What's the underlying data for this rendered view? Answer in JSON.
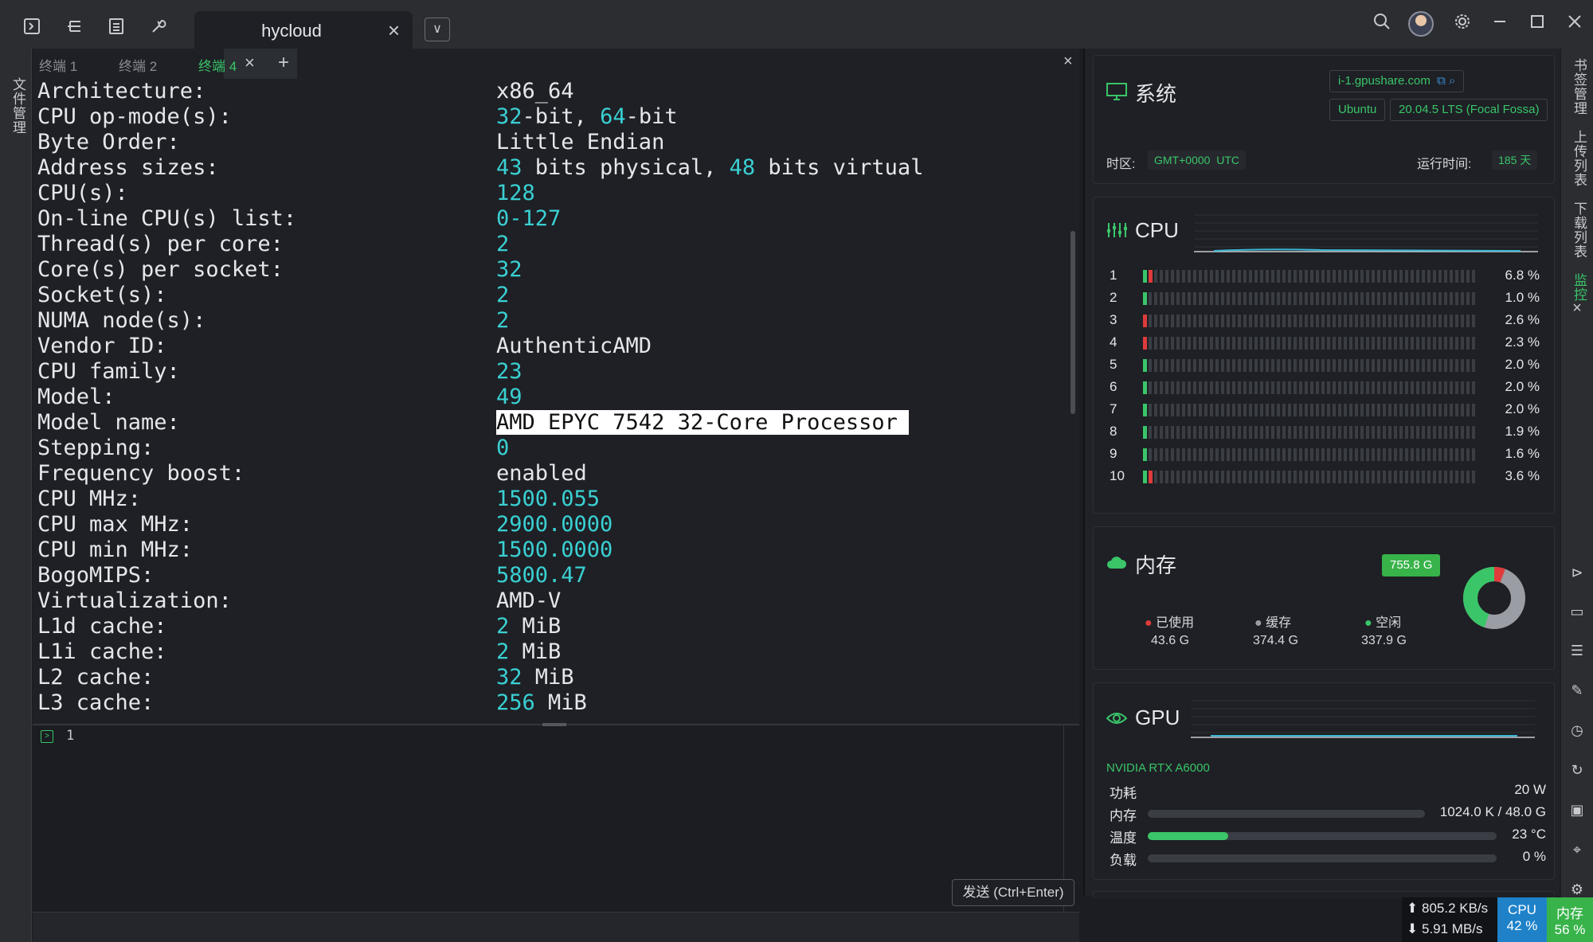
{
  "tabs": {
    "main_title": "hycloud"
  },
  "left_strip": {
    "label": "文件管理"
  },
  "terminal_tabs": [
    {
      "label": "终端 1"
    },
    {
      "label": "终端 2"
    },
    {
      "label": "终端 4"
    }
  ],
  "terminal": {
    "lines": [
      {
        "key": "Architecture:",
        "value": "x86_64"
      },
      {
        "key": "CPU op-mode(s):",
        "value_parts": [
          "32",
          "-bit, ",
          "64",
          "-bit"
        ]
      },
      {
        "key": "Byte Order:",
        "value": "Little Endian"
      },
      {
        "key": "Address sizes:",
        "value_parts": [
          "43",
          " bits physical, ",
          "48",
          " bits virtual"
        ]
      },
      {
        "key": "CPU(s):",
        "value": "128"
      },
      {
        "key": "On-line CPU(s) list:",
        "value": "0-127"
      },
      {
        "key": "Thread(s) per core:",
        "value": "2"
      },
      {
        "key": "Core(s) per socket:",
        "value": "32"
      },
      {
        "key": "Socket(s):",
        "value": "2"
      },
      {
        "key": "NUMA node(s):",
        "value": "2"
      },
      {
        "key": "Vendor ID:",
        "value": "AuthenticAMD"
      },
      {
        "key": "CPU family:",
        "value": "23"
      },
      {
        "key": "Model:",
        "value": "49"
      },
      {
        "key": "Model name:",
        "value": "AMD EPYC 7542 32-Core Processor"
      },
      {
        "key": "Stepping:",
        "value": "0"
      },
      {
        "key": "Frequency boost:",
        "value": "enabled"
      },
      {
        "key": "CPU MHz:",
        "value": "1500.055"
      },
      {
        "key": "CPU max MHz:",
        "value": "2900.0000"
      },
      {
        "key": "CPU min MHz:",
        "value": "1500.0000"
      },
      {
        "key": "BogoMIPS:",
        "value": "5800.47"
      },
      {
        "key": "Virtualization:",
        "value": "AMD-V"
      },
      {
        "key": "L1d cache:",
        "value_parts": [
          "2",
          " MiB"
        ]
      },
      {
        "key": "L1i cache:",
        "value_parts": [
          "2",
          " MiB"
        ]
      },
      {
        "key": "L2 cache:",
        "value_parts": [
          "32",
          " MiB"
        ]
      },
      {
        "key": "L3 cache:",
        "value_parts": [
          "256",
          " MiB"
        ]
      }
    ]
  },
  "input": {
    "line_number": "1",
    "send_label": "发送 (Ctrl+Enter)"
  },
  "system": {
    "title": "系统",
    "host": "i-1.gpushare.com",
    "os": "Ubuntu",
    "version": "20.04.5 LTS (Focal Fossa)",
    "tz_label": "时区:",
    "tz_value": "GMT+0000",
    "tz_name": "UTC",
    "uptime_label": "运行时间:",
    "uptime_value": "185 天"
  },
  "cpu": {
    "title": "CPU",
    "cores": [
      {
        "idx": "1",
        "pct": "6.8 %",
        "value": 6.8
      },
      {
        "idx": "2",
        "pct": "1.0 %",
        "value": 1.0
      },
      {
        "idx": "3",
        "pct": "2.6 %",
        "value": 2.6
      },
      {
        "idx": "4",
        "pct": "2.3 %",
        "value": 2.3
      },
      {
        "idx": "5",
        "pct": "2.0 %",
        "value": 2.0
      },
      {
        "idx": "6",
        "pct": "2.0 %",
        "value": 2.0
      },
      {
        "idx": "7",
        "pct": "2.0 %",
        "value": 2.0
      },
      {
        "idx": "8",
        "pct": "1.9 %",
        "value": 1.9
      },
      {
        "idx": "9",
        "pct": "1.6 %",
        "value": 1.6
      },
      {
        "idx": "10",
        "pct": "3.6 %",
        "value": 3.6
      }
    ]
  },
  "memory": {
    "title": "内存",
    "total": "755.8 G",
    "used_label": "已使用",
    "used_value": "43.6 G",
    "cache_label": "缓存",
    "cache_value": "374.4 G",
    "free_label": "空闲",
    "free_value": "337.9 G",
    "colors": {
      "used": "#e03b3b",
      "cache": "#9a9da3",
      "free": "#3ac569"
    }
  },
  "gpu": {
    "title": "GPU",
    "model": "NVIDIA RTX A6000",
    "power_label": "功耗",
    "power_value": "20 W",
    "mem_label": "内存",
    "mem_value": "1024.0 K / 48.0 G",
    "mem_fraction": 0.0,
    "temp_label": "温度",
    "temp_value": "23 °C",
    "temp_fraction": 0.23,
    "load_label": "负载",
    "load_value": "0 %",
    "load_fraction": 0.0
  },
  "right_labels": {
    "bookmarks": "书签管理",
    "upload": "上传列表",
    "download": "下载列表",
    "monitor": "监控"
  },
  "status": {
    "up": "805.2 KB/s",
    "down": "5.91 MB/s",
    "cpu_label": "CPU",
    "cpu_value": "42 %",
    "mem_label": "内存",
    "mem_value": "56 %"
  },
  "colors": {
    "accent": "#3ac569",
    "number": "#3ad0d3",
    "cpu_widget": "#1f82c9",
    "mem_widget": "#38b34a"
  }
}
